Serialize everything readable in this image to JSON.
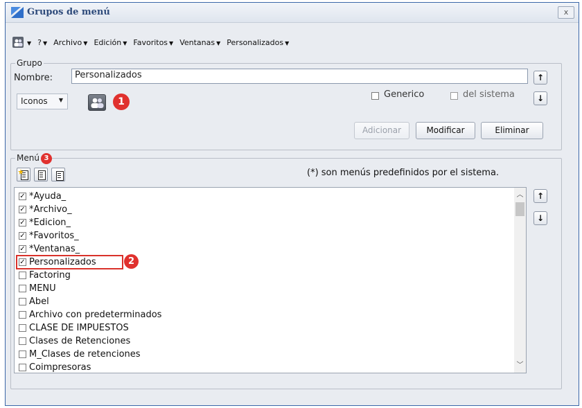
{
  "window": {
    "title": "Grupos de menú",
    "close_label": "x"
  },
  "menubar": {
    "items": [
      {
        "label": "?"
      },
      {
        "label": "Archivo"
      },
      {
        "label": "Edición"
      },
      {
        "label": "Favoritos"
      },
      {
        "label": "Ventanas"
      },
      {
        "label": "Personalizados"
      }
    ]
  },
  "grupo": {
    "legend": "Grupo",
    "nombre_label": "Nombre:",
    "nombre_value": "Personalizados",
    "icon_select": "Iconos",
    "generico_label": "Generico",
    "generico_checked": false,
    "sistema_label": "del sistema",
    "sistema_checked": false,
    "buttons": {
      "adicionar": "Adicionar",
      "modificar": "Modificar",
      "eliminar": "Eliminar"
    },
    "up_arrow": "↑",
    "down_arrow": "↓"
  },
  "menu": {
    "legend": "Menú",
    "note": "(*) son menús predefinidos por el sistema.",
    "up_arrow": "↑",
    "down_arrow": "↓",
    "items": [
      {
        "label": "*Ayuda_",
        "checked": true
      },
      {
        "label": "*Archivo_",
        "checked": true
      },
      {
        "label": "*Edicion_",
        "checked": true
      },
      {
        "label": "*Favoritos_",
        "checked": true
      },
      {
        "label": "*Ventanas_",
        "checked": true
      },
      {
        "label": "Personalizados",
        "checked": true
      },
      {
        "label": "Factoring",
        "checked": false
      },
      {
        "label": "MENU",
        "checked": false
      },
      {
        "label": "Abel",
        "checked": false
      },
      {
        "label": "Archivo con predeterminados",
        "checked": false
      },
      {
        "label": "CLASE DE IMPUESTOS",
        "checked": false
      },
      {
        "label": "Clases de Retenciones",
        "checked": false
      },
      {
        "label": "M_Clases de retenciones",
        "checked": false
      },
      {
        "label": "Coimpresoras",
        "checked": false
      }
    ]
  },
  "annotations": {
    "one": "1",
    "two": "2",
    "three": "3"
  },
  "colors": {
    "accent": "#2d4a7a",
    "annotation_red": "#e0312e"
  }
}
